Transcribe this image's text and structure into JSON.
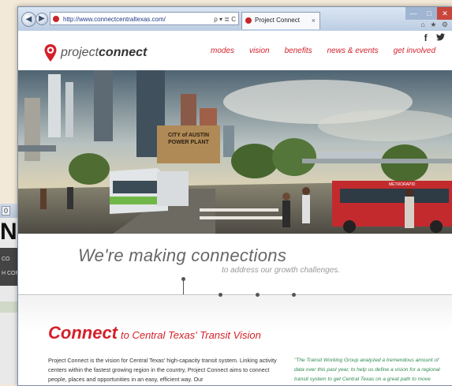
{
  "background_window": {
    "tab_label": "0",
    "logo_fragment": "N",
    "nav_fragment_1": "CO",
    "nav_fragment_2": "H CORR"
  },
  "browser": {
    "back_glyph": "◀",
    "forward_glyph": "▶",
    "url": "http://www.connectcentraltexas.com/",
    "address_controls": "ρ ▾ ≣ C",
    "tab_title": "Project Connect",
    "tab_close": "×",
    "window_controls": [
      "—",
      "□",
      "✕"
    ],
    "toolbar_icons": "⌂ ★ ⚙"
  },
  "site": {
    "logo_prefix": "project",
    "logo_suffix": "connect",
    "social": [
      "f",
      "🐦"
    ],
    "nav": [
      "modes",
      "vision",
      "benefits",
      "news & events",
      "get involved"
    ],
    "hero_signs": {
      "power_plant_line1": "CITY of AUSTIN",
      "power_plant_line2": "POWER PLANT",
      "bus_label": "METRORAPID"
    },
    "tagline": "We're making connections",
    "subtagline": "to address our growth challenges.",
    "section_title_bold": "Connect",
    "section_title_rest": "to Central Texas' Transit Vision",
    "body_text": "Project Connect is the vision for Central Texas' high-capacity transit system. Linking activity centers within the fastest growing region in the country, Project Connect aims to connect people, places and opportunities in an easy, efficient way. Our",
    "quote_text": "\"The Transit Working Group analyzed a tremendous amount of data over this past year, to help us define a vision for a regional transit system to get Central Texas on a great path to move"
  },
  "colors": {
    "brand_red": "#d4202a",
    "quote_green": "#2f8b52"
  }
}
